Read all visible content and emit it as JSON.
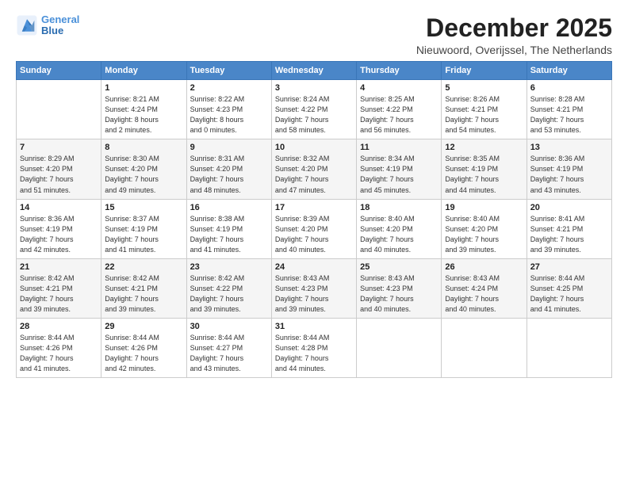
{
  "logo": {
    "line1": "General",
    "line2": "Blue"
  },
  "title": "December 2025",
  "subtitle": "Nieuwoord, Overijssel, The Netherlands",
  "days_of_week": [
    "Sunday",
    "Monday",
    "Tuesday",
    "Wednesday",
    "Thursday",
    "Friday",
    "Saturday"
  ],
  "weeks": [
    [
      {
        "day": "",
        "info": ""
      },
      {
        "day": "1",
        "info": "Sunrise: 8:21 AM\nSunset: 4:24 PM\nDaylight: 8 hours\nand 2 minutes."
      },
      {
        "day": "2",
        "info": "Sunrise: 8:22 AM\nSunset: 4:23 PM\nDaylight: 8 hours\nand 0 minutes."
      },
      {
        "day": "3",
        "info": "Sunrise: 8:24 AM\nSunset: 4:22 PM\nDaylight: 7 hours\nand 58 minutes."
      },
      {
        "day": "4",
        "info": "Sunrise: 8:25 AM\nSunset: 4:22 PM\nDaylight: 7 hours\nand 56 minutes."
      },
      {
        "day": "5",
        "info": "Sunrise: 8:26 AM\nSunset: 4:21 PM\nDaylight: 7 hours\nand 54 minutes."
      },
      {
        "day": "6",
        "info": "Sunrise: 8:28 AM\nSunset: 4:21 PM\nDaylight: 7 hours\nand 53 minutes."
      }
    ],
    [
      {
        "day": "7",
        "info": "Sunrise: 8:29 AM\nSunset: 4:20 PM\nDaylight: 7 hours\nand 51 minutes."
      },
      {
        "day": "8",
        "info": "Sunrise: 8:30 AM\nSunset: 4:20 PM\nDaylight: 7 hours\nand 49 minutes."
      },
      {
        "day": "9",
        "info": "Sunrise: 8:31 AM\nSunset: 4:20 PM\nDaylight: 7 hours\nand 48 minutes."
      },
      {
        "day": "10",
        "info": "Sunrise: 8:32 AM\nSunset: 4:20 PM\nDaylight: 7 hours\nand 47 minutes."
      },
      {
        "day": "11",
        "info": "Sunrise: 8:34 AM\nSunset: 4:19 PM\nDaylight: 7 hours\nand 45 minutes."
      },
      {
        "day": "12",
        "info": "Sunrise: 8:35 AM\nSunset: 4:19 PM\nDaylight: 7 hours\nand 44 minutes."
      },
      {
        "day": "13",
        "info": "Sunrise: 8:36 AM\nSunset: 4:19 PM\nDaylight: 7 hours\nand 43 minutes."
      }
    ],
    [
      {
        "day": "14",
        "info": "Sunrise: 8:36 AM\nSunset: 4:19 PM\nDaylight: 7 hours\nand 42 minutes."
      },
      {
        "day": "15",
        "info": "Sunrise: 8:37 AM\nSunset: 4:19 PM\nDaylight: 7 hours\nand 41 minutes."
      },
      {
        "day": "16",
        "info": "Sunrise: 8:38 AM\nSunset: 4:19 PM\nDaylight: 7 hours\nand 41 minutes."
      },
      {
        "day": "17",
        "info": "Sunrise: 8:39 AM\nSunset: 4:20 PM\nDaylight: 7 hours\nand 40 minutes."
      },
      {
        "day": "18",
        "info": "Sunrise: 8:40 AM\nSunset: 4:20 PM\nDaylight: 7 hours\nand 40 minutes."
      },
      {
        "day": "19",
        "info": "Sunrise: 8:40 AM\nSunset: 4:20 PM\nDaylight: 7 hours\nand 39 minutes."
      },
      {
        "day": "20",
        "info": "Sunrise: 8:41 AM\nSunset: 4:21 PM\nDaylight: 7 hours\nand 39 minutes."
      }
    ],
    [
      {
        "day": "21",
        "info": "Sunrise: 8:42 AM\nSunset: 4:21 PM\nDaylight: 7 hours\nand 39 minutes."
      },
      {
        "day": "22",
        "info": "Sunrise: 8:42 AM\nSunset: 4:21 PM\nDaylight: 7 hours\nand 39 minutes."
      },
      {
        "day": "23",
        "info": "Sunrise: 8:42 AM\nSunset: 4:22 PM\nDaylight: 7 hours\nand 39 minutes."
      },
      {
        "day": "24",
        "info": "Sunrise: 8:43 AM\nSunset: 4:23 PM\nDaylight: 7 hours\nand 39 minutes."
      },
      {
        "day": "25",
        "info": "Sunrise: 8:43 AM\nSunset: 4:23 PM\nDaylight: 7 hours\nand 40 minutes."
      },
      {
        "day": "26",
        "info": "Sunrise: 8:43 AM\nSunset: 4:24 PM\nDaylight: 7 hours\nand 40 minutes."
      },
      {
        "day": "27",
        "info": "Sunrise: 8:44 AM\nSunset: 4:25 PM\nDaylight: 7 hours\nand 41 minutes."
      }
    ],
    [
      {
        "day": "28",
        "info": "Sunrise: 8:44 AM\nSunset: 4:26 PM\nDaylight: 7 hours\nand 41 minutes."
      },
      {
        "day": "29",
        "info": "Sunrise: 8:44 AM\nSunset: 4:26 PM\nDaylight: 7 hours\nand 42 minutes."
      },
      {
        "day": "30",
        "info": "Sunrise: 8:44 AM\nSunset: 4:27 PM\nDaylight: 7 hours\nand 43 minutes."
      },
      {
        "day": "31",
        "info": "Sunrise: 8:44 AM\nSunset: 4:28 PM\nDaylight: 7 hours\nand 44 minutes."
      },
      {
        "day": "",
        "info": ""
      },
      {
        "day": "",
        "info": ""
      },
      {
        "day": "",
        "info": ""
      }
    ]
  ]
}
